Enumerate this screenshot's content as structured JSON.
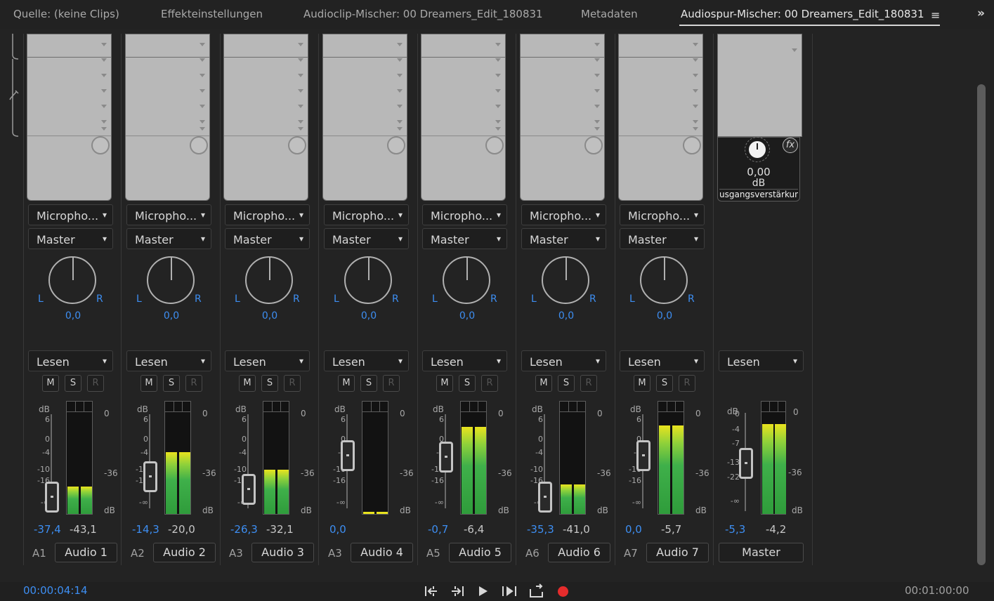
{
  "tabs": [
    {
      "label": "Quelle: (keine Clips)"
    },
    {
      "label": "Effekteinstellungen"
    },
    {
      "label": "Audioclip-Mischer: 00 Dreamers_Edit_180831"
    },
    {
      "label": "Metadaten"
    },
    {
      "label": "Audiospur-Mischer: 00 Dreamers_Edit_180831"
    }
  ],
  "tab_menu_icon": "≡",
  "overflow_icon": "»",
  "tracks": [
    {
      "id": "A1",
      "name": "Audio 1",
      "input": "Micropho...",
      "output": "Master",
      "pan": "0,0",
      "mode": "Lesen",
      "fader_db": "-37,4",
      "meter_db": "-43,1",
      "fader_level": 0.18,
      "meter_level": 0.27
    },
    {
      "id": "A2",
      "name": "Audio 2",
      "input": "Micropho...",
      "output": "Master",
      "pan": "0,0",
      "mode": "Lesen",
      "fader_db": "-14,3",
      "meter_db": "-20,0",
      "fader_level": 0.45,
      "meter_level": 0.6
    },
    {
      "id": "A3",
      "name": "Audio 3",
      "input": "Micropho...",
      "output": "Master",
      "pan": "0,0",
      "mode": "Lesen",
      "fader_db": "-26,3",
      "meter_db": "-32,1",
      "fader_level": 0.28,
      "meter_level": 0.43
    },
    {
      "id": "A3",
      "name": "Audio 4",
      "input": "Micropho...",
      "output": "Master",
      "pan": "0,0",
      "mode": "Lesen",
      "fader_db": "0,0",
      "meter_db": "",
      "fader_level": 0.72,
      "meter_level": 0.02
    },
    {
      "id": "A5",
      "name": "Audio 5",
      "input": "Micropho...",
      "output": "Master",
      "pan": "0,0",
      "mode": "Lesen",
      "fader_db": "-0,7",
      "meter_db": "-6,4",
      "fader_level": 0.7,
      "meter_level": 0.85
    },
    {
      "id": "A6",
      "name": "Audio 6",
      "input": "Micropho...",
      "output": "Master",
      "pan": "0,0",
      "mode": "Lesen",
      "fader_db": "-35,3",
      "meter_db": "-41,0",
      "fader_level": 0.18,
      "meter_level": 0.29
    },
    {
      "id": "A7",
      "name": "Audio 7",
      "input": "Micropho...",
      "output": "Master",
      "pan": "0,0",
      "mode": "Lesen",
      "fader_db": "0,0",
      "meter_db": "-5,7",
      "fader_level": 0.72,
      "meter_level": 0.86
    }
  ],
  "pan_L": "L",
  "pan_R": "R",
  "btn_mute": "M",
  "btn_solo": "S",
  "btn_record": "R",
  "db_caption": "dB",
  "meter_scale_top": "0",
  "meter_scale_mid": "-36",
  "meter_scale_bottom": "dB",
  "fader_scale": [
    "6",
    "0",
    "-4",
    "-10",
    "-16",
    "-∞"
  ],
  "master": {
    "name": "Master",
    "mode": "Lesen",
    "volume_value": "0,00",
    "volume_unit": "dB",
    "volume_label": "usgangsverstärkun",
    "fx_label": "fx",
    "fader_db": "-5,3",
    "meter_db": "-4,2",
    "fader_level": 0.62,
    "meter_level": 0.88,
    "fader_scale": [
      "0",
      "-4",
      "-7",
      "-13",
      "-22",
      "-∞"
    ]
  },
  "footer": {
    "timecode_current": "00:00:04:14",
    "timecode_duration": "00:01:00:00"
  },
  "transport_icons": [
    "go-to-in-icon",
    "go-to-out-icon",
    "play-icon",
    "play-in-to-out-icon",
    "loop-icon",
    "record-icon"
  ],
  "colors": {
    "accent": "#3d8ef2",
    "meter_green": "#3fb04a",
    "meter_yellow": "#e9e31e",
    "record": "#e52c2c"
  }
}
